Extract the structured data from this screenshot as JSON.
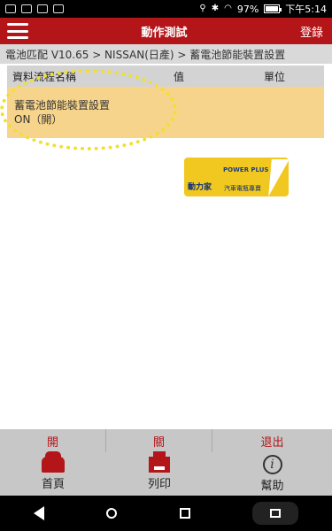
{
  "status_bar": {
    "battery": "97%",
    "time": "下午5:14",
    "battery_level": 0.97
  },
  "header": {
    "title": "動作測試",
    "login_label": "登錄",
    "accent_color": "#b31519"
  },
  "breadcrumb": {
    "text": "電池匹配 V10.65 > NISSAN(日產) > 蓄電池節能裝置設置"
  },
  "table": {
    "columns": [
      "資料流程名稱",
      "值",
      "單位"
    ],
    "rows": [
      {
        "name": "蓄電池節能裝置設置",
        "value": "ON（開）"
      }
    ]
  },
  "logo": {
    "brand_en": "POWER PLUS",
    "brand_cn": "動力家",
    "brand_sub": "汽車電瓶專賣"
  },
  "actions": {
    "on_label": "開",
    "off_label": "關",
    "exit_label": "退出"
  },
  "nav": {
    "home_label": "首頁",
    "print_label": "列印",
    "help_label": "幫助"
  },
  "icons": {
    "menu": "hamburger-icon",
    "home": "car-icon",
    "print": "printer-icon",
    "help": "info-icon"
  }
}
